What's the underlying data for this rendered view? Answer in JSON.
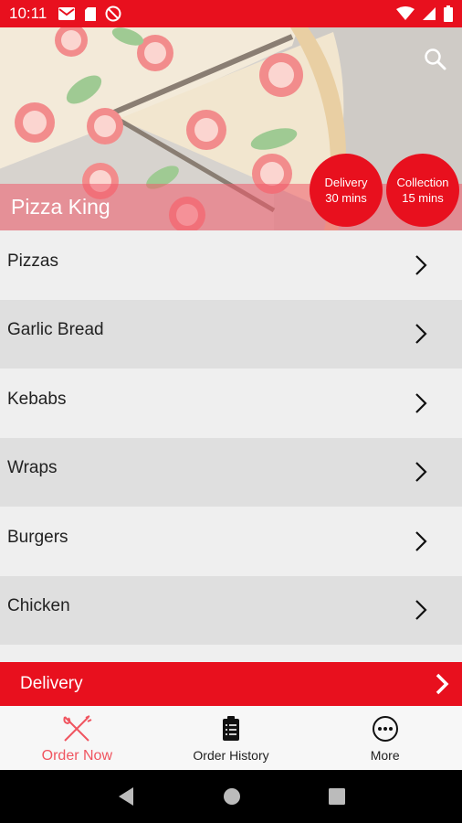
{
  "status_bar": {
    "time": "10:11",
    "left_icons": [
      "gmail-icon",
      "sd-card-icon",
      "do-not-disturb-icon"
    ],
    "right_icons": [
      "wifi-icon",
      "signal-icon",
      "battery-icon"
    ]
  },
  "header": {
    "restaurant_name": "Pizza King",
    "delivery": {
      "label": "Delivery",
      "time": "30 mins"
    },
    "collection": {
      "label": "Collection",
      "time": "15 mins"
    },
    "search_icon": "search-icon"
  },
  "menu": {
    "items": [
      {
        "label": "Pizzas"
      },
      {
        "label": "Garlic Bread"
      },
      {
        "label": "Kebabs"
      },
      {
        "label": "Wraps"
      },
      {
        "label": "Burgers"
      },
      {
        "label": "Chicken"
      }
    ]
  },
  "order_mode": {
    "label": "Delivery"
  },
  "tabs": [
    {
      "label": "Order Now",
      "icon": "fork-knife-icon",
      "active": true
    },
    {
      "label": "Order History",
      "icon": "clipboard-icon",
      "active": false
    },
    {
      "label": "More",
      "icon": "more-icon",
      "active": false
    }
  ],
  "colors": {
    "accent": "#e8101e",
    "active_tab": "#f05560"
  }
}
